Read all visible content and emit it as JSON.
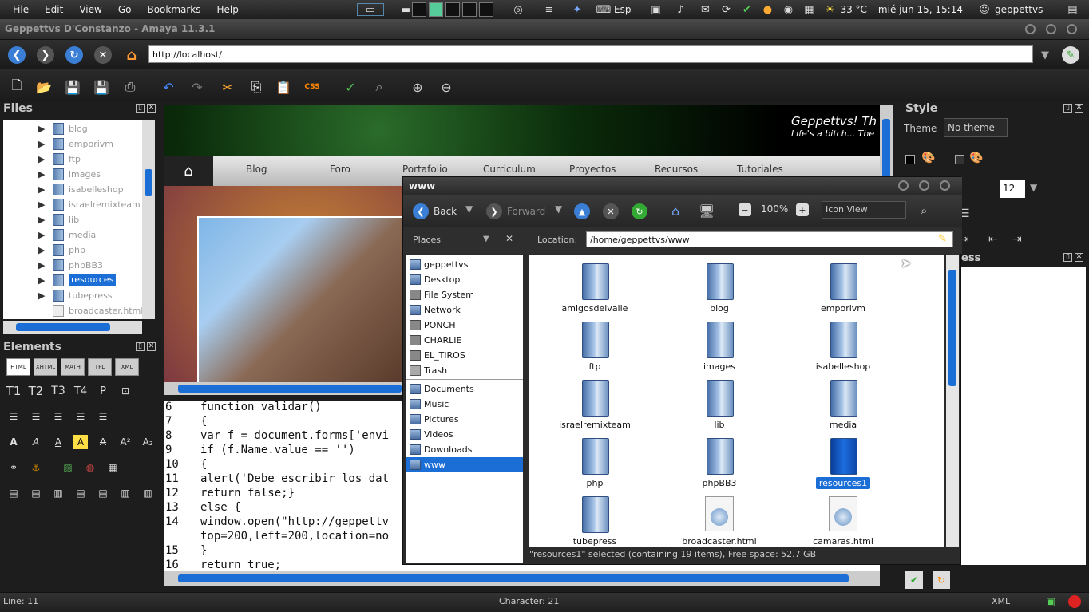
{
  "top_panel": {
    "menu": [
      "File",
      "Edit",
      "View",
      "Go",
      "Bookmarks",
      "Help"
    ],
    "keyboard_layout": "Esp",
    "temperature": "33 °C",
    "datetime": "mié jun 15, 15:14",
    "user": "geppettvs"
  },
  "window": {
    "title": "Geppettvs D'Constanzo - Amaya 11.3.1"
  },
  "urlbar": {
    "url": "http://localhost/"
  },
  "files_panel": {
    "title": "Files",
    "items": [
      {
        "name": "blog",
        "type": "folder"
      },
      {
        "name": "emporivm",
        "type": "folder"
      },
      {
        "name": "ftp",
        "type": "folder"
      },
      {
        "name": "images",
        "type": "folder"
      },
      {
        "name": "isabelleshop",
        "type": "folder"
      },
      {
        "name": "israelremixteam",
        "type": "folder"
      },
      {
        "name": "lib",
        "type": "folder"
      },
      {
        "name": "media",
        "type": "folder"
      },
      {
        "name": "php",
        "type": "folder"
      },
      {
        "name": "phpBB3",
        "type": "folder"
      },
      {
        "name": "resources",
        "type": "folder",
        "selected": true
      },
      {
        "name": "tubepress",
        "type": "folder"
      },
      {
        "name": "broadcaster.html",
        "type": "file"
      }
    ]
  },
  "elements_panel": {
    "title": "Elements",
    "tabs": [
      "HTML",
      "XHTML",
      "MATH",
      "TPL",
      "XML"
    ],
    "heading_icons": [
      "T1",
      "T2",
      "T3",
      "T4",
      "P"
    ]
  },
  "document": {
    "site_title": "Geppettvs! Th",
    "site_subtitle": "Life's a bitch... The",
    "nav": [
      "Blog",
      "Foro",
      "Portafolio",
      "Curriculum",
      "Proyectos",
      "Recursos",
      "Tutoriales"
    ]
  },
  "source": {
    "lines": [
      {
        "n": "6",
        "code": "function validar()"
      },
      {
        "n": "7",
        "code": "{"
      },
      {
        "n": "8",
        "code": "var f = document.forms['envi"
      },
      {
        "n": "9",
        "code": "if (f.Name.value == '')"
      },
      {
        "n": "10",
        "code": "{"
      },
      {
        "n": "11",
        "code": "alert('Debe escribir los dat"
      },
      {
        "n": "12",
        "code": "return false;}"
      },
      {
        "n": "13",
        "code": "else {"
      },
      {
        "n": "14",
        "code": "window.open(\"http://geppettv"
      },
      {
        "n": "",
        "code": "top=200,left=200,location=no"
      },
      {
        "n": "15",
        "code": "}"
      },
      {
        "n": "16",
        "code": "return true;"
      }
    ]
  },
  "style_panel": {
    "title": "Style",
    "theme_label": "Theme",
    "theme_value": "No theme",
    "font_size": "12",
    "panel2_title": "ess"
  },
  "statusbar": {
    "line": "Line: 11",
    "character": "Character: 21",
    "mode": "XML"
  },
  "nautilus": {
    "title": "www",
    "back": "Back",
    "forward": "Forward",
    "zoom": "100%",
    "view_mode": "Icon View",
    "places_label": "Places",
    "location_label": "Location:",
    "location": "/home/geppettvs/www",
    "places": [
      {
        "name": "geppettvs"
      },
      {
        "name": "Desktop"
      },
      {
        "name": "File System"
      },
      {
        "name": "Network"
      },
      {
        "name": "PONCH"
      },
      {
        "name": "CHARLIE"
      },
      {
        "name": "EL_TIROS"
      },
      {
        "name": "Trash"
      },
      {
        "name": "Documents"
      },
      {
        "name": "Music"
      },
      {
        "name": "Pictures"
      },
      {
        "name": "Videos"
      },
      {
        "name": "Downloads"
      },
      {
        "name": "www",
        "selected": true
      }
    ],
    "files": [
      {
        "name": "amigosdelvalle",
        "type": "folder"
      },
      {
        "name": "blog",
        "type": "folder"
      },
      {
        "name": "emporivm",
        "type": "folder"
      },
      {
        "name": "ftp",
        "type": "folder"
      },
      {
        "name": "images",
        "type": "folder"
      },
      {
        "name": "isabelleshop",
        "type": "folder"
      },
      {
        "name": "israelremixteam",
        "type": "folder"
      },
      {
        "name": "lib",
        "type": "folder"
      },
      {
        "name": "media",
        "type": "folder"
      },
      {
        "name": "php",
        "type": "folder"
      },
      {
        "name": "phpBB3",
        "type": "folder"
      },
      {
        "name": "resources1",
        "type": "folder",
        "selected": true
      },
      {
        "name": "tubepress",
        "type": "folder"
      },
      {
        "name": "broadcaster.html",
        "type": "html"
      },
      {
        "name": "camaras.html",
        "type": "html"
      }
    ],
    "status": "\"resources1\" selected (containing 19 items), Free space: 52.7 GB"
  },
  "colors": {
    "selection": "#1b6ed6",
    "panel_bg": "#1d1d1d"
  }
}
